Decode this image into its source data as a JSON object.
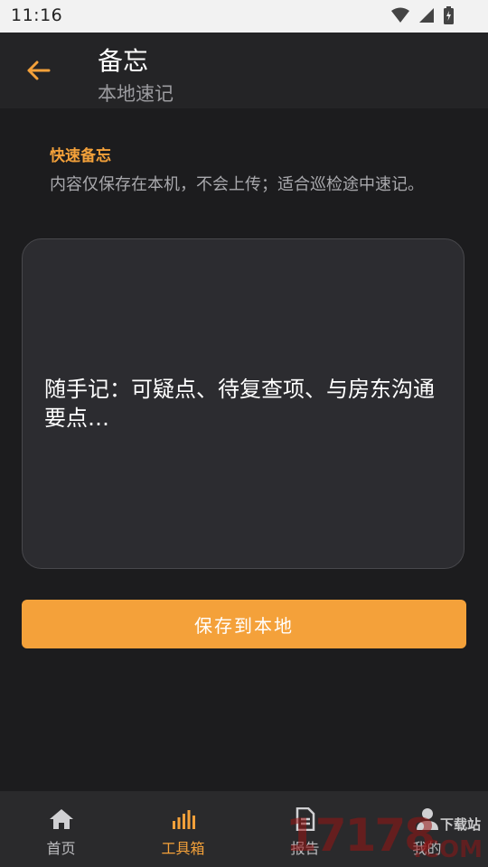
{
  "status_bar": {
    "time": "11:16"
  },
  "app_bar": {
    "title": "备忘",
    "subtitle": "本地速记"
  },
  "memo": {
    "section_title": "快速备忘",
    "section_desc": "内容仅保存在本机，不会上传；适合巡检途中速记。",
    "placeholder": "随手记：可疑点、待复查项、与房东沟通要点…"
  },
  "save_button": {
    "label": "保存到本地"
  },
  "bottom_nav": {
    "items": [
      {
        "label": "首页",
        "icon": "home-icon",
        "active": false
      },
      {
        "label": "工具箱",
        "icon": "toolbox-icon",
        "active": true
      },
      {
        "label": "报告",
        "icon": "report-icon",
        "active": false
      },
      {
        "label": "我的",
        "icon": "profile-icon",
        "active": false
      }
    ]
  },
  "watermark": {
    "number": "17178",
    "site": "下载站",
    "domain": ".COM"
  },
  "colors": {
    "accent": "#f4a13a",
    "background": "#1c1c1e",
    "appbar": "#242426",
    "nav": "#2a2a2c"
  }
}
